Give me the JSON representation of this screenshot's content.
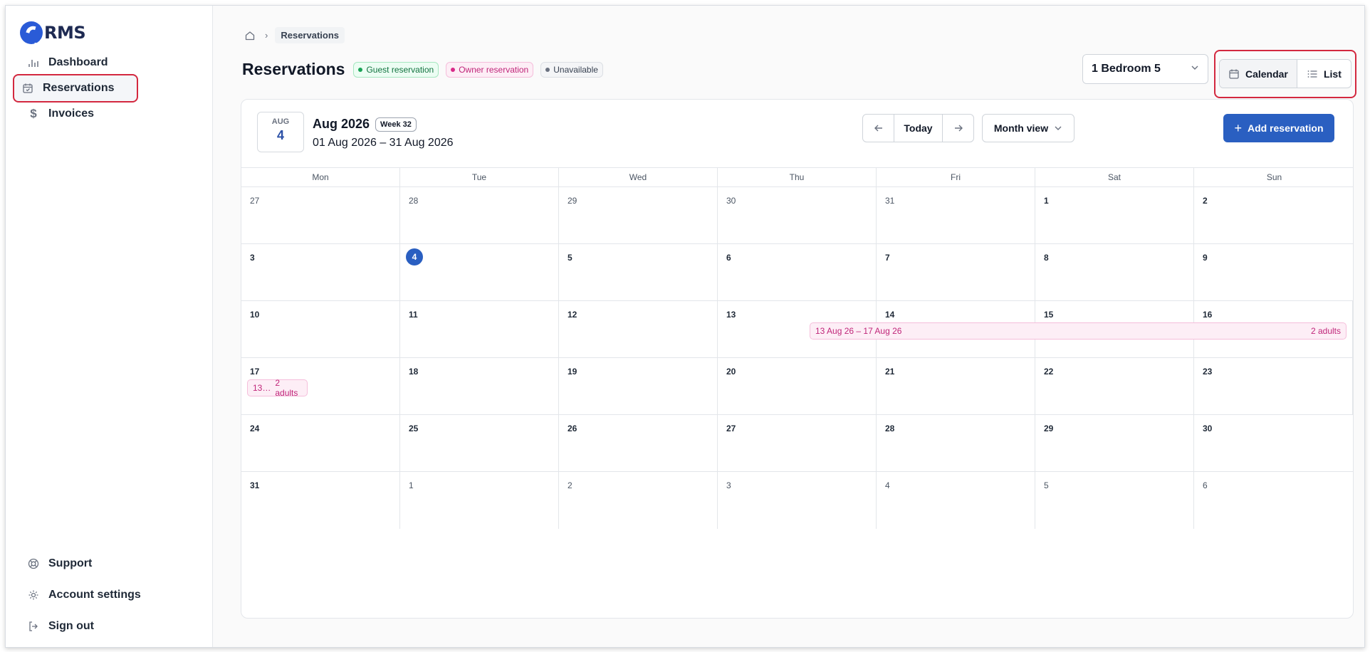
{
  "app": {
    "logo_text": "RMS"
  },
  "sidebar": {
    "items": [
      {
        "label": "Dashboard"
      },
      {
        "label": "Reservations"
      },
      {
        "label": "Invoices"
      }
    ],
    "bottom_items": [
      {
        "label": "Support"
      },
      {
        "label": "Account settings"
      },
      {
        "label": "Sign out"
      }
    ]
  },
  "breadcrumb": {
    "current": "Reservations"
  },
  "page": {
    "title": "Reservations",
    "legend": [
      {
        "label": "Guest reservation",
        "color": "#1aa356"
      },
      {
        "label": "Owner reservation",
        "color": "#d92b8a"
      },
      {
        "label": "Unavailable",
        "color": "#6b7280"
      }
    ]
  },
  "property_select": {
    "value": "1 Bedroom 5"
  },
  "view_toggle": {
    "calendar": "Calendar",
    "list": "List",
    "active": "Calendar"
  },
  "calendar": {
    "date_box": {
      "month": "AUG",
      "day": "4"
    },
    "month_label": "Aug 2026",
    "week_badge": "Week 32",
    "range_label": "01 Aug 2026 – 31 Aug 2026",
    "today_label": "Today",
    "mode": "Month view",
    "add_label": "Add reservation",
    "weekdays": [
      "Mon",
      "Tue",
      "Wed",
      "Thu",
      "Fri",
      "Sat",
      "Sun"
    ],
    "weeks": [
      [
        "27",
        "28",
        "29",
        "30",
        "31",
        "1",
        "2"
      ],
      [
        "3",
        "4",
        "5",
        "6",
        "7",
        "8",
        "9"
      ],
      [
        "10",
        "11",
        "12",
        "13",
        "14",
        "15",
        "16"
      ],
      [
        "17",
        "18",
        "19",
        "20",
        "21",
        "22",
        "23"
      ],
      [
        "24",
        "25",
        "26",
        "27",
        "28",
        "29",
        "30"
      ],
      [
        "31",
        "1",
        "2",
        "3",
        "4",
        "5",
        "6"
      ]
    ],
    "reservation": {
      "range_text": "13 Aug 26 – 17 Aug 26",
      "guests": "2 adults",
      "continued_short": "13…",
      "continued_guests": "2 adults"
    }
  }
}
